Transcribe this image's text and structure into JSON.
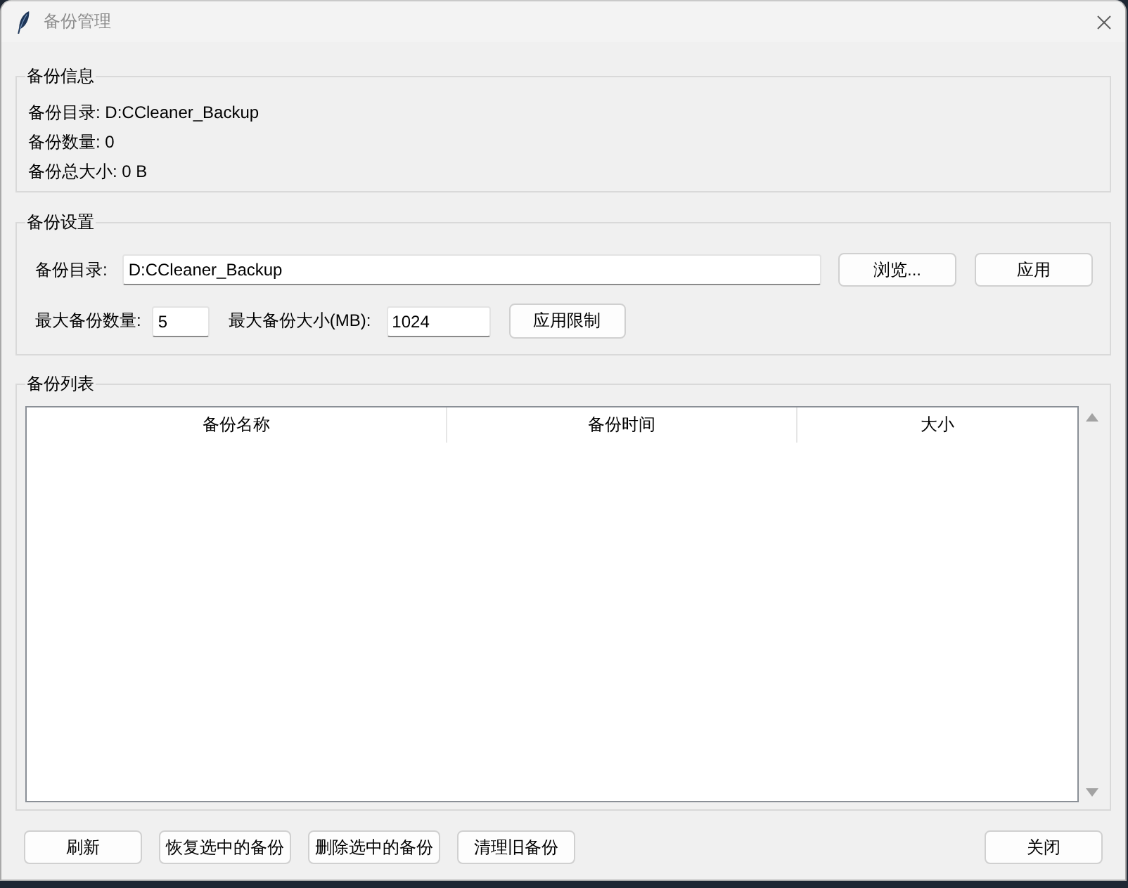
{
  "window": {
    "title": "备份管理"
  },
  "backup_info": {
    "title": "备份信息",
    "lines": [
      "备份目录: D:CCleaner_Backup",
      "备份数量: 0",
      "备份总大小: 0 B"
    ]
  },
  "backup_settings": {
    "title": "备份设置",
    "directory": {
      "label": "备份目录:",
      "value": "D:CCleaner_Backup"
    },
    "browse_button": {
      "label": "浏览..."
    },
    "apply_button": {
      "label": "应用"
    },
    "max_count": {
      "label": "最大备份数量:",
      "value": "5"
    },
    "max_size": {
      "label": "最大备份大小(MB):",
      "value": "1024"
    },
    "apply_limits_button": {
      "label": "应用限制"
    }
  },
  "backup_list": {
    "title": "备份列表",
    "columns": [
      "备份名称",
      "备份时间",
      "大小"
    ]
  },
  "actions": [
    {
      "label": "刷新"
    },
    {
      "label": "恢复选中的备份"
    },
    {
      "label": "删除选中的备份"
    },
    {
      "label": "清理旧备份"
    }
  ],
  "close_button": {
    "label": "关闭"
  }
}
